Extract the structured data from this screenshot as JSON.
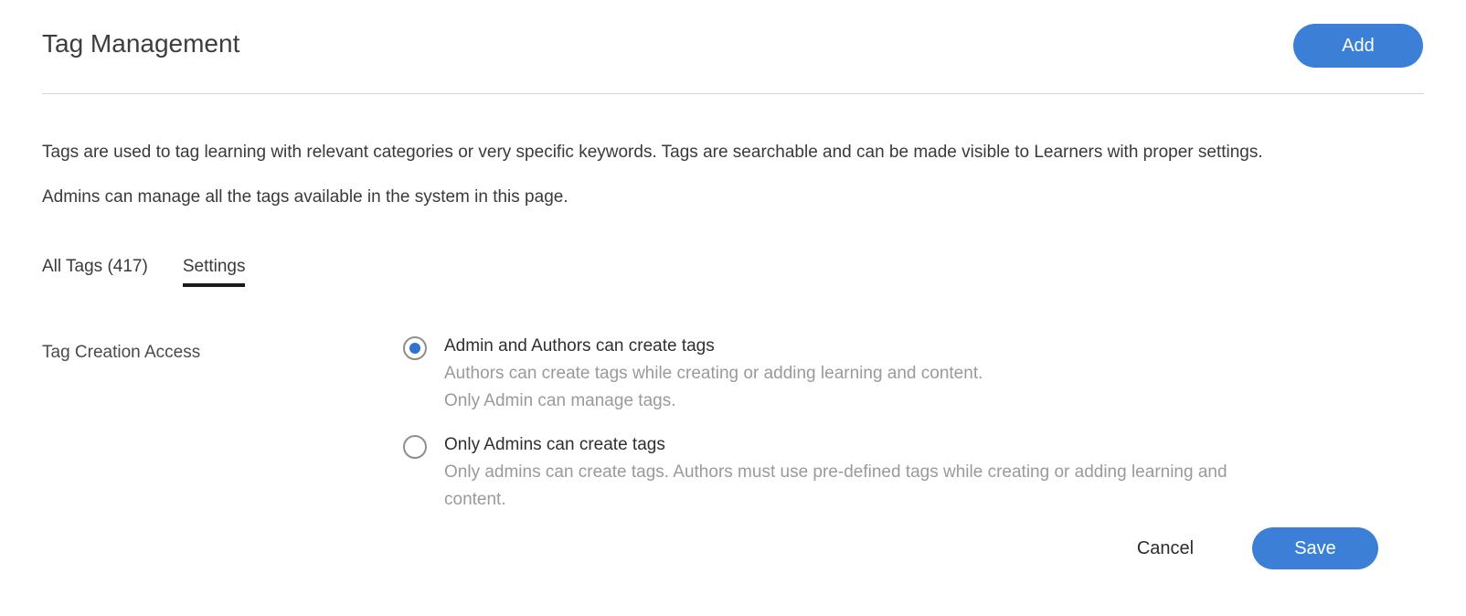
{
  "header": {
    "title": "Tag Management",
    "add_label": "Add"
  },
  "description": {
    "line1": "Tags are used to tag learning with relevant categories or very specific keywords. Tags are searchable and can be made visible to Learners with proper settings.",
    "line2": "Admins can manage all the tags available in the system in this page."
  },
  "tabs": [
    {
      "label": "All Tags (417)",
      "active": false
    },
    {
      "label": "Settings",
      "active": true
    }
  ],
  "settings": {
    "section_label": "Tag Creation Access",
    "options": [
      {
        "title": "Admin and Authors can create tags",
        "desc_line1": "Authors can create tags while creating or adding learning and content.",
        "desc_line2": "Only Admin can manage tags.",
        "selected": true
      },
      {
        "title": "Only Admins can create tags",
        "desc_line1": "Only admins can create tags. Authors must use pre-defined tags while creating or adding learning and content.",
        "selected": false
      }
    ]
  },
  "footer": {
    "cancel_label": "Cancel",
    "save_label": "Save"
  },
  "colors": {
    "accent": "#3b80d6",
    "radio_selected": "#2f72d0",
    "muted_text": "#9a9a9a",
    "divider": "#d6d6d6"
  }
}
